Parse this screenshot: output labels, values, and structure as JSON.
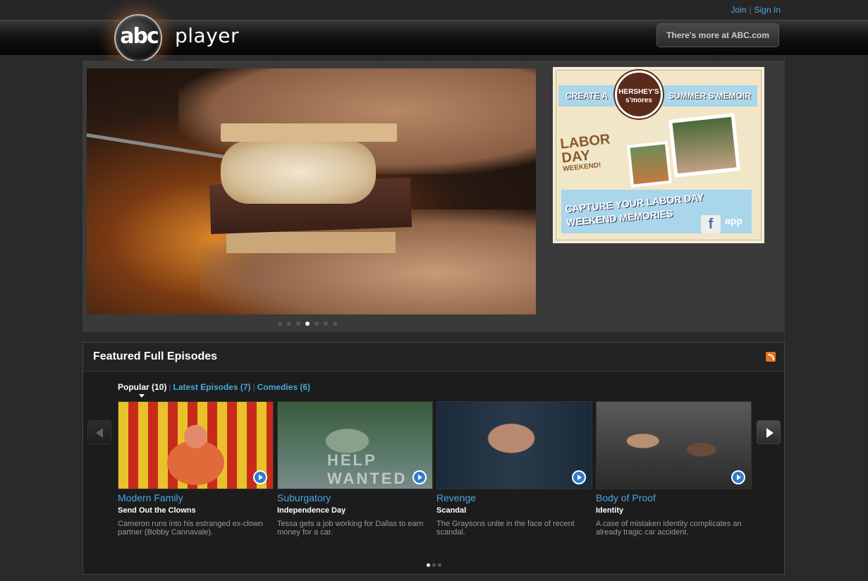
{
  "header": {
    "join_label": "Join",
    "signin_label": "Sign In",
    "logo_text": "abc",
    "logo_subtitle": "player",
    "more_button_label": "There's more at ABC.com"
  },
  "hero": {
    "slide_count": 7,
    "active_slide": 4
  },
  "ad": {
    "top_left": "CREATE A",
    "badge_line1": "HERSHEY'S",
    "badge_line2": "s'mores",
    "top_right": "SUMMER S'MEMOIR",
    "labor_line1": "LABOR",
    "labor_line2": "DAY",
    "labor_line3": "WEEKEND!",
    "capture_line1": "CAPTURE YOUR LABOR DAY",
    "capture_line2": "WEEKEND MEMORIES",
    "fb_letter": "f",
    "app_label": "app"
  },
  "featured": {
    "title": "Featured Full Episodes",
    "tabs": [
      {
        "label": "Popular (10)",
        "active": true
      },
      {
        "label": "Latest Episodes (7)",
        "active": false
      },
      {
        "label": "Comedies (6)",
        "active": false
      }
    ],
    "episodes": [
      {
        "show": "Modern Family",
        "episode": "Send Out the Clowns",
        "description": "Cameron runs into his estranged ex-clown partner (Bobby Cannavale)."
      },
      {
        "show": "Suburgatory",
        "episode": "Independence Day",
        "description": "Tessa gets a job working for Dallas to earn money for a car.",
        "thumb_text": "HELP WANTED"
      },
      {
        "show": "Revenge",
        "episode": "Scandal",
        "description": "The Graysons unite in the face of recent scandal."
      },
      {
        "show": "Body of Proof",
        "episode": "Identity",
        "description": "A case of mistaken identity complicates an already tragic car accident."
      }
    ],
    "page_count": 3,
    "active_page": 1
  },
  "colors": {
    "link_blue": "#4aa6e0",
    "play_blue": "#2e7bd4",
    "rss_orange": "#e8731a"
  }
}
